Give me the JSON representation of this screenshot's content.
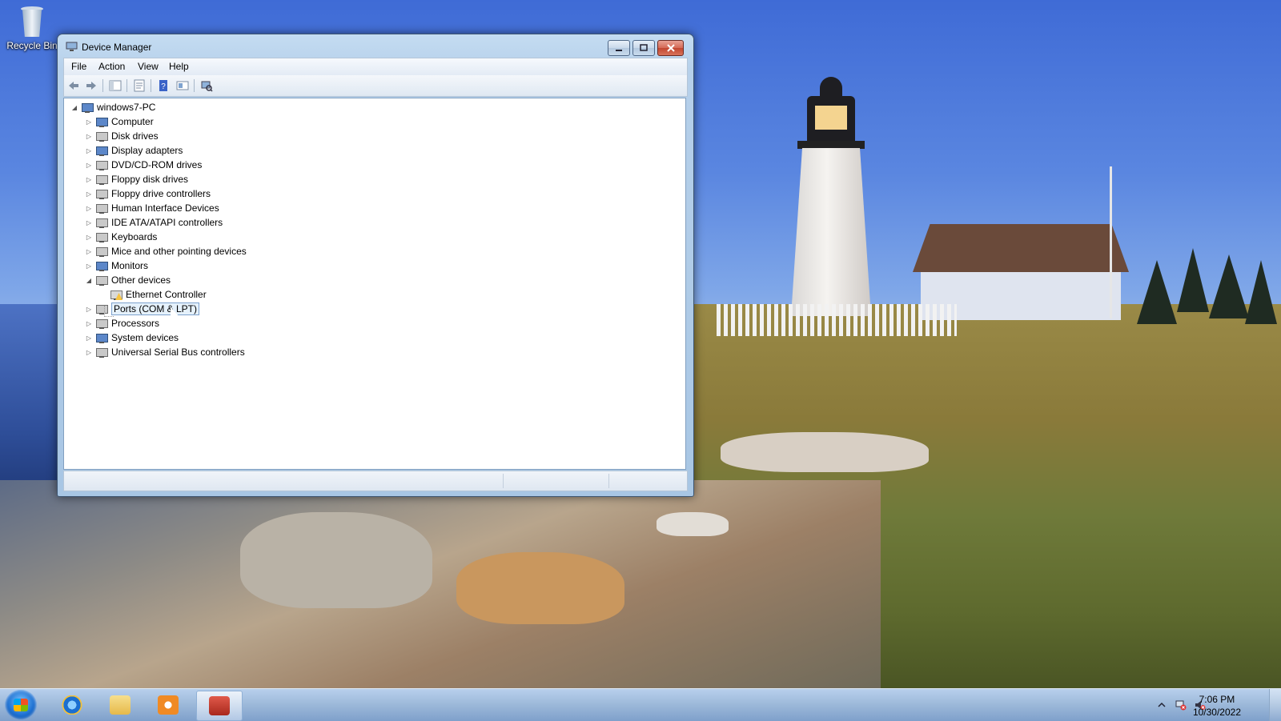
{
  "desktop": {
    "icons": [
      {
        "label": "Recycle Bin",
        "icon": "recycle-bin-icon"
      }
    ]
  },
  "window": {
    "title": "Device Manager",
    "controls": {
      "minimize": "minimize-icon",
      "maximize": "maximize-icon",
      "close": "close-icon"
    },
    "menu": [
      "File",
      "Action",
      "View",
      "Help"
    ],
    "toolbar": [
      "back-icon",
      "forward-icon",
      "show-hide-console-tree-icon",
      "properties-icon",
      "help-icon",
      "update-driver-icon",
      "scan-hardware-icon"
    ],
    "tree": {
      "root": "windows7-PC",
      "items": [
        {
          "label": "Computer",
          "icon": "computer-icon",
          "expanded": false
        },
        {
          "label": "Disk drives",
          "icon": "disk-drive-icon",
          "expanded": false
        },
        {
          "label": "Display adapters",
          "icon": "display-adapter-icon",
          "expanded": false
        },
        {
          "label": "DVD/CD-ROM drives",
          "icon": "dvd-drive-icon",
          "expanded": false
        },
        {
          "label": "Floppy disk drives",
          "icon": "floppy-disk-icon",
          "expanded": false
        },
        {
          "label": "Floppy drive controllers",
          "icon": "floppy-controller-icon",
          "expanded": false
        },
        {
          "label": "Human Interface Devices",
          "icon": "hid-icon",
          "expanded": false
        },
        {
          "label": "IDE ATA/ATAPI controllers",
          "icon": "ide-controller-icon",
          "expanded": false
        },
        {
          "label": "Keyboards",
          "icon": "keyboard-icon",
          "expanded": false
        },
        {
          "label": "Mice and other pointing devices",
          "icon": "mouse-icon",
          "expanded": false
        },
        {
          "label": "Monitors",
          "icon": "monitor-icon",
          "expanded": false
        },
        {
          "label": "Other devices",
          "icon": "unknown-device-icon",
          "expanded": true,
          "children": [
            {
              "label": "Ethernet Controller",
              "icon": "warning-device-icon"
            }
          ]
        },
        {
          "label": "Ports (COM & LPT)",
          "icon": "port-icon",
          "expanded": false,
          "selected": true
        },
        {
          "label": "Processors",
          "icon": "processor-icon",
          "expanded": false
        },
        {
          "label": "System devices",
          "icon": "system-device-icon",
          "expanded": false
        },
        {
          "label": "Universal Serial Bus controllers",
          "icon": "usb-icon",
          "expanded": false
        }
      ]
    }
  },
  "taskbar": {
    "start": "windows-start-icon",
    "pinned": [
      "internet-explorer-icon",
      "windows-explorer-icon",
      "media-player-icon",
      "device-manager-taskbar-icon"
    ],
    "tray": {
      "icons": [
        "show-hidden-icons-arrow",
        "network-icon",
        "volume-muted-icon"
      ],
      "time": "7:06 PM",
      "date": "10/30/2022"
    }
  },
  "colors": {
    "selection_bg": "#e5f1fb",
    "selection_border": "#7da2ce",
    "close_button": "#c24630",
    "window_frame": "#b6d0ea"
  }
}
